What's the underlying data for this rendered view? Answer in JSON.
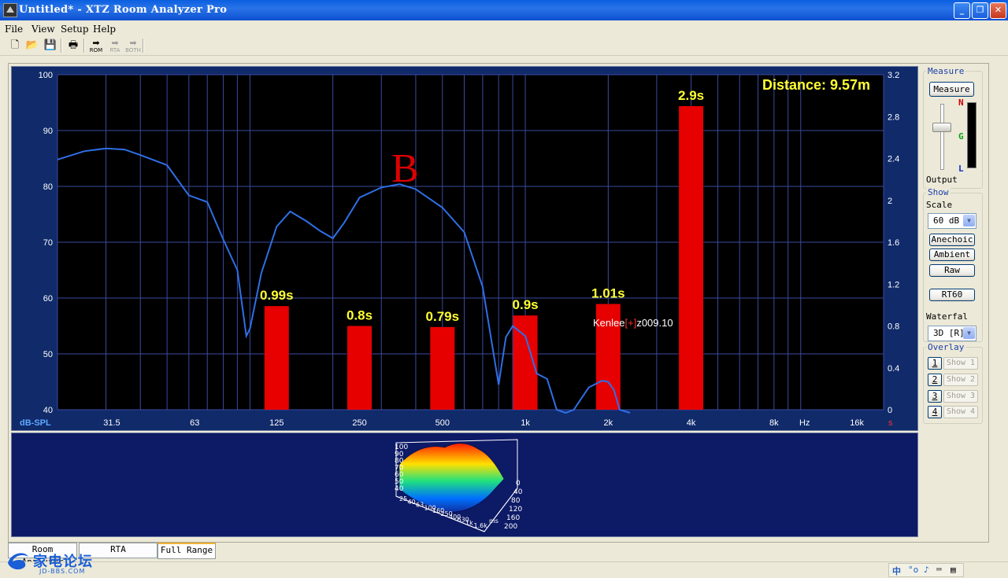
{
  "window": {
    "title": "Untitled* - XTZ Room Analyzer Pro",
    "buttons": {
      "minimize": "_",
      "maximize": "❐",
      "close": "✕"
    }
  },
  "menu": {
    "file": "File",
    "view": "View",
    "setup": "Setup",
    "help": "Help"
  },
  "toolbar": {
    "rom": "ROM",
    "rta": "RTA",
    "both": "BOTH"
  },
  "graph": {
    "distance": "Distance: 9.57m",
    "annotation": "B",
    "watermark_name": "Kenlee",
    "watermark_tag": "[+]",
    "watermark_date": "z009.10",
    "y_left_title": "dB-SPL",
    "x_unit_label": "Hz",
    "y_right_unit": "s",
    "colors": {
      "background": "#000000",
      "grid": "#3a4aa0",
      "curve": "#2f6fe6",
      "bar": "#e60000",
      "bar_label": "#ffff33",
      "frame": "#102a6a",
      "axis_text": "#ffffff"
    }
  },
  "chart_data": {
    "type": "bar+line",
    "x_scale": "log",
    "x_ticks": [
      "31.5",
      "63",
      "125",
      "250",
      "500",
      "1k",
      "2k",
      "4k",
      "8k",
      "16k"
    ],
    "x_tick_values": [
      31.5,
      63,
      125,
      250,
      500,
      1000,
      2000,
      4000,
      8000,
      16000
    ],
    "xlim": [
      20,
      20000
    ],
    "y_left": {
      "label": "dB-SPL",
      "ylim": [
        40,
        100
      ],
      "ticks": [
        40,
        50,
        60,
        70,
        80,
        90,
        100
      ]
    },
    "y_right": {
      "label": "s",
      "ylim": [
        0,
        3.2
      ],
      "ticks": [
        "0",
        "0.4",
        "0.8",
        "1.2",
        "1.6",
        "2",
        "2.4",
        "2.8",
        "3.2"
      ]
    },
    "bars": {
      "name": "RT60",
      "categories": [
        "125",
        "250",
        "500",
        "1k",
        "2k",
        "4k"
      ],
      "freqs": [
        125,
        250,
        500,
        1000,
        2000,
        4000
      ],
      "values": [
        0.99,
        0.8,
        0.79,
        0.9,
        1.01,
        2.9
      ],
      "labels": [
        "0.99s",
        "0.8s",
        "0.79s",
        "0.9s",
        "1.01s",
        "2.9s"
      ]
    },
    "series": [
      {
        "name": "frequency-response",
        "x": [
          20,
          25,
          30,
          35,
          40,
          50,
          60,
          70,
          80,
          90,
          97,
          100,
          110,
          125,
          140,
          160,
          180,
          200,
          220,
          250,
          300,
          350,
          400,
          500,
          600,
          700,
          800,
          850,
          900,
          1000,
          1100,
          1200,
          1300,
          1400,
          1500,
          1700,
          1900,
          2000,
          2100,
          2200,
          2400
        ],
        "y": [
          84.8,
          86.3,
          86.8,
          86.6,
          85.6,
          83.8,
          78.4,
          77.2,
          70.5,
          65.0,
          53.2,
          54.5,
          64.5,
          72.8,
          75.5,
          73.8,
          72.0,
          70.7,
          73.5,
          78.0,
          79.8,
          80.4,
          79.5,
          76.2,
          71.8,
          62.0,
          44.5,
          53.0,
          55.0,
          53.2,
          46.5,
          45.5,
          40.0,
          38.0,
          40.0,
          44.0,
          45.2,
          45.0,
          43.5,
          40.0,
          38.0
        ]
      }
    ]
  },
  "waterfall3d": {
    "z_ticks": [
      "100",
      "90",
      "80",
      "70",
      "60",
      "50",
      "40"
    ],
    "freq_ticks": [
      "25",
      "40",
      "63",
      "100",
      "160",
      "250",
      "400",
      "630",
      "1k",
      "1.6k"
    ],
    "time_ticks": [
      "0",
      "40",
      "80",
      "120",
      "160",
      "200"
    ],
    "time_unit": "ms"
  },
  "panel": {
    "measure_group": "Measure",
    "measure_button": "Measure",
    "meter_n": "N",
    "meter_g": "G",
    "meter_l": "L",
    "output_label": "Output",
    "show_group": "Show",
    "scale_label": "Scale",
    "scale_value": "60 dB",
    "anechoic": "Anechoic",
    "ambient": "Ambient",
    "raw": "Raw",
    "rt60": "RT60",
    "waterfall_label": "Waterfal",
    "waterfall_value": "3D [R]",
    "overlay_group": "Overlay",
    "overlays": [
      {
        "num": "1",
        "label": "Show 1"
      },
      {
        "num": "2",
        "label": "Show 2"
      },
      {
        "num": "3",
        "label": "Show 3"
      },
      {
        "num": "4",
        "label": "Show 4"
      }
    ]
  },
  "tabs": [
    "Room Analyzer",
    "RTA",
    "Full Range"
  ],
  "status": {
    "logo_text": "家电论坛",
    "logo_sub": "JD-BBS.COM",
    "ime": [
      "中",
      "°o",
      "♪",
      "⌨",
      "▤"
    ]
  }
}
